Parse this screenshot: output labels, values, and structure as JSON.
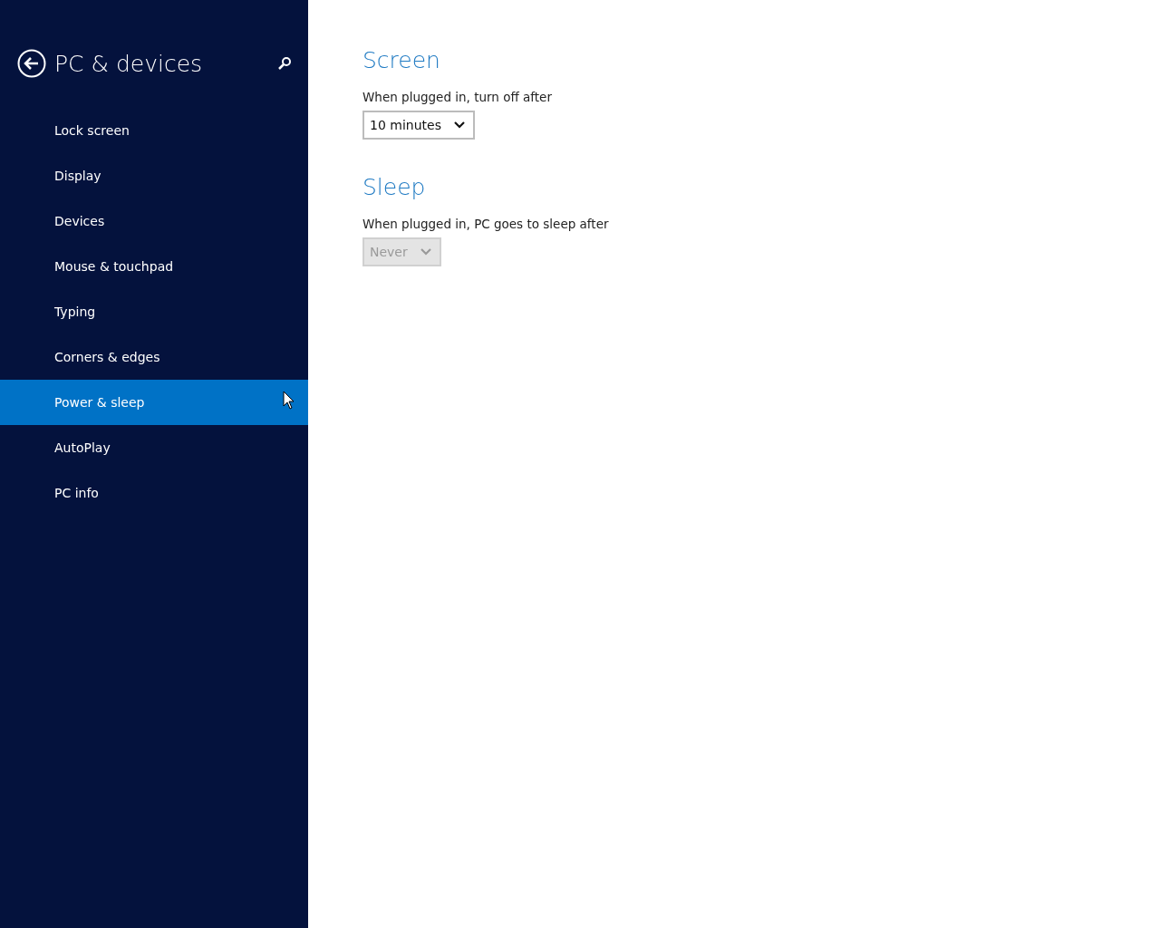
{
  "sidebar": {
    "title": "PC & devices",
    "items": [
      {
        "label": "Lock screen",
        "selected": false
      },
      {
        "label": "Display",
        "selected": false
      },
      {
        "label": "Devices",
        "selected": false
      },
      {
        "label": "Mouse & touchpad",
        "selected": false
      },
      {
        "label": "Typing",
        "selected": false
      },
      {
        "label": "Corners & edges",
        "selected": false
      },
      {
        "label": "Power & sleep",
        "selected": true
      },
      {
        "label": "AutoPlay",
        "selected": false
      },
      {
        "label": "PC info",
        "selected": false
      }
    ]
  },
  "sections": [
    {
      "heading": "Screen",
      "label": "When plugged in, turn off after",
      "dropdown": {
        "value": "10 minutes",
        "disabled": false
      }
    },
    {
      "heading": "Sleep",
      "label": "When plugged in, PC goes to sleep after",
      "dropdown": {
        "value": "Never",
        "disabled": true
      }
    }
  ]
}
